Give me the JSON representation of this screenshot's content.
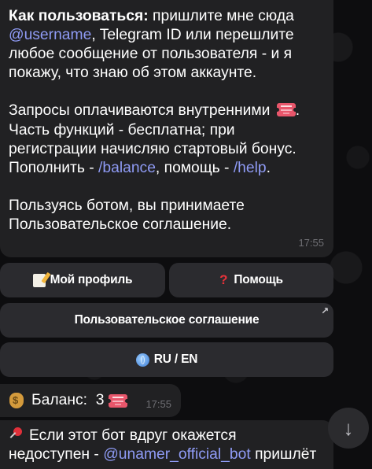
{
  "message": {
    "intro_bold": "Как пользоваться:",
    "intro_text1": " пришлите мне сюда",
    "username_link": "@username",
    "intro_text2": ", Telegram ID или перешлите",
    "line3": "любое сообщение от пользователя - и я",
    "line4": "покажу, что знаю об этом аккаунте.",
    "paid_line": "Запросы оплачиваются внутренними",
    "paid_dot": ".",
    "free_line1": "Часть функций - бесплатна; при",
    "free_line2": "регистрации начисляю стартовый бонус.",
    "topup_text": "Пополнить - ",
    "balance_link": "/balance",
    "help_text": ", помощь - ",
    "help_link": "/help",
    "help_dot": ".",
    "terms_line1": "Пользуясь ботом, вы принимаете",
    "terms_line2": "Пользовательское соглашение.",
    "time": "17:55"
  },
  "keyboard": {
    "profile_label": "Мой профиль",
    "help_label": "Помощь",
    "terms_label": "Пользовательское соглашение",
    "lang_label": "RU / EN"
  },
  "balance_msg": {
    "label": "Баланс:",
    "value": "3",
    "time": "17:55"
  },
  "pinned_msg": {
    "line1": "Если этот бот вдруг окажется",
    "line2_prefix": "недоступен - ",
    "bot_link": "@unamer_official_bot",
    "line2_suffix": " пришлёт"
  },
  "icons": {
    "ticket": "ticket-icon",
    "memo": "memo-icon",
    "question": "question-icon",
    "globe": "globe-icon",
    "moneybag": "moneybag-icon",
    "pin": "pushpin-icon",
    "scroll": "arrow-down-icon"
  },
  "colors": {
    "bubble": "#212123",
    "link": "#8f9bf5",
    "ticket": "#e8566b"
  }
}
